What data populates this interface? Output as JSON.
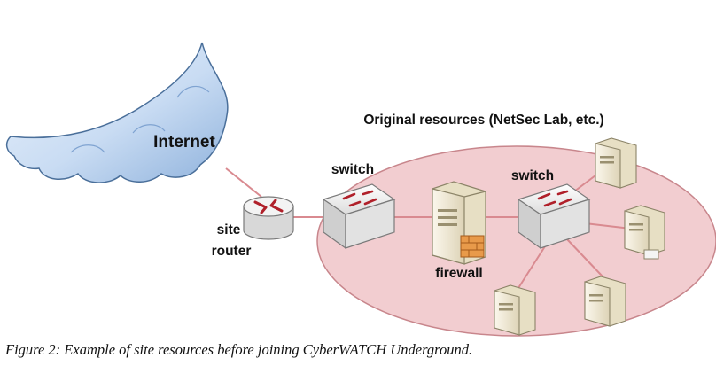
{
  "labels": {
    "internet": "Internet",
    "region": "Original resources (NetSec Lab, etc.)",
    "switch_left": "switch",
    "switch_right": "switch",
    "router_line1": "site",
    "router_line2": "router",
    "firewall": "firewall"
  },
  "caption": "Figure 2: Example of site resources before joining CyberWATCH Underground.",
  "colors": {
    "region_fill": "#f2cdd0",
    "region_stroke": "#c8868c",
    "link": "#d98a90",
    "cloud_fill": "#c9dcf3",
    "cloud_stroke": "#4a6f9a",
    "arrow": "#b0202a",
    "device_fill": "#ededed",
    "device_stroke": "#7a7a7a",
    "server_fill": "#f1ead6",
    "server_stroke": "#8c8468"
  },
  "icons": {
    "internet": "cloud-icon",
    "router": "router-icon",
    "switch": "switch-icon",
    "firewall": "firewall-server-icon",
    "server": "server-icon"
  }
}
